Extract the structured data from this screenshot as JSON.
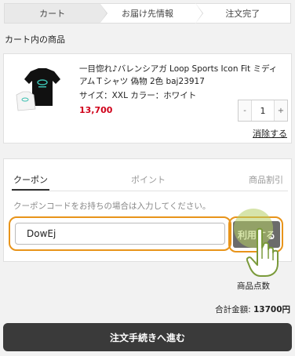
{
  "steps": [
    {
      "label": "カート",
      "active": true
    },
    {
      "label": "お届け先情報",
      "active": false
    },
    {
      "label": "注文完了",
      "active": false
    }
  ],
  "cart": {
    "section_title": "カート内の商品",
    "item": {
      "name": "一目惚れ♪バレンシアガ Loop Sports Icon Fit ミディアムＴシャツ 偽物 2色 baj23917",
      "size_color": "サイズ：XXL カラー：ホワイト",
      "price": "13,700",
      "qty_minus": "-",
      "qty_value": "1",
      "qty_plus": "+",
      "delete_label": "消除する"
    }
  },
  "coupon": {
    "tabs": [
      "クーポン",
      "ポイント",
      "商品割引"
    ],
    "hint": "クーポンコードをお持ちの場合は入力してください。",
    "input_value": "DowEj",
    "apply_label": "利用する"
  },
  "summary": {
    "points_label": "商品点数",
    "total_label": "合計金額:",
    "total_value": "13700円"
  },
  "checkout_label": "注文手続きへ進む",
  "colors": {
    "accent_orange": "#e8941a",
    "price_red": "#d0021b",
    "dark_button": "#3a3a3a",
    "apply_button": "#6b6b6b"
  },
  "icons": [
    "tshirt-thumbnail",
    "pointing-hand-icon"
  ]
}
